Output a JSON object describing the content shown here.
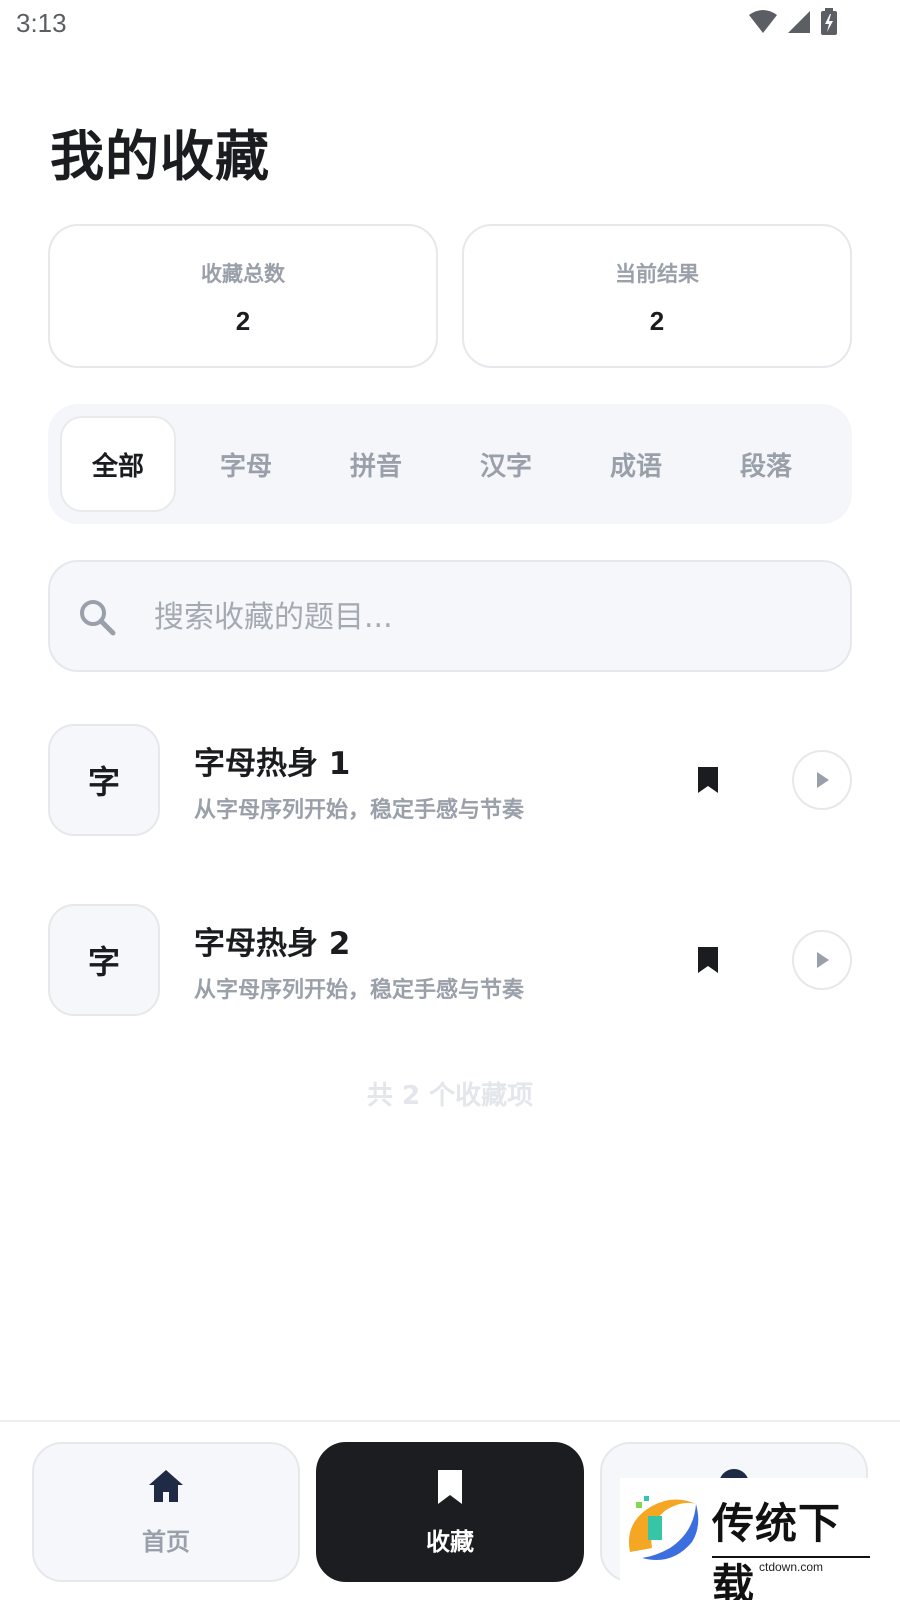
{
  "status_bar": {
    "time": "3:13"
  },
  "title": "我的收藏",
  "stats": [
    {
      "label": "收藏总数",
      "value": "2"
    },
    {
      "label": "当前结果",
      "value": "2"
    }
  ],
  "tabs": [
    {
      "label": "全部",
      "active": true
    },
    {
      "label": "字母"
    },
    {
      "label": "拼音"
    },
    {
      "label": "汉字"
    },
    {
      "label": "成语"
    },
    {
      "label": "段落"
    }
  ],
  "search": {
    "placeholder": "搜索收藏的题目...",
    "value": ""
  },
  "items": [
    {
      "badge": "字",
      "title": "字母热身 1",
      "subtitle": "从字母序列开始，稳定手感与节奏"
    },
    {
      "badge": "字",
      "title": "字母热身 2",
      "subtitle": "从字母序列开始，稳定手感与节奏"
    }
  ],
  "footer": {
    "count_text": "共 2 个收藏项"
  },
  "nav": [
    {
      "label": "首页",
      "icon": "home-icon"
    },
    {
      "label": "收藏",
      "icon": "bookmark-icon",
      "active": true
    },
    {
      "label": "",
      "icon": "user-icon"
    }
  ],
  "watermark": {
    "brand": "传统下载",
    "site": "ctdown.com"
  },
  "colors": {
    "primary_dark": "#1c1d20",
    "muted_text": "#9aa0aa",
    "card_border": "#e6e8ec",
    "panel_bg": "#f4f6f9"
  }
}
